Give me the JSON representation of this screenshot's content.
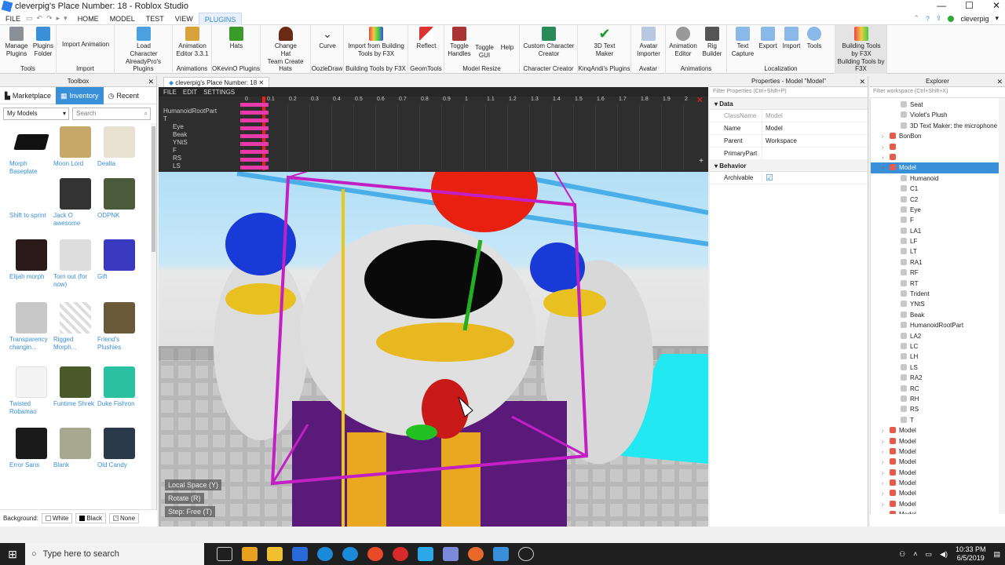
{
  "window": {
    "title": "cleverpig's Place Number: 18 - Roblox Studio",
    "min": "—",
    "max": "☐",
    "close": "✕"
  },
  "menubar": {
    "items": [
      "FILE",
      "HOME",
      "MODEL",
      "TEST",
      "VIEW",
      "PLUGINS"
    ],
    "active": "PLUGINS",
    "user": "cleverpig"
  },
  "ribbon": {
    "groups": [
      {
        "label": "Tools",
        "buttons": [
          "Manage Plugins",
          "Plugins Folder"
        ]
      },
      {
        "label": "Import",
        "buttons": [
          "Import Animation"
        ]
      },
      {
        "label": "AlreadyPro's Plugins",
        "buttons": [
          "Load Character"
        ]
      },
      {
        "label": "Animations",
        "buttons": [
          "Animation Editor 3.3.1"
        ]
      },
      {
        "label": "OKevinO Plugins",
        "buttons": [
          "Hats"
        ]
      },
      {
        "label": "Team Create Hats",
        "buttons": [
          "Change Hat"
        ]
      },
      {
        "label": "OozleDraw",
        "buttons": [
          "Curve"
        ]
      },
      {
        "label": "Building Tools by F3X",
        "buttons": [
          "Import from Building Tools by F3X"
        ]
      },
      {
        "label": "GeomTools",
        "buttons": [
          "Reflect"
        ]
      },
      {
        "label": "Model Resize",
        "buttons": [
          "Toggle Handles",
          "Toggle GUI",
          "Help"
        ]
      },
      {
        "label": "Character Creator",
        "buttons": [
          "Custom Character Creator"
        ]
      },
      {
        "label": "KinqAndi's Plugins",
        "buttons": [
          "3D Text Maker"
        ]
      },
      {
        "label": "Avatar",
        "buttons": [
          "Avatar Importer"
        ]
      },
      {
        "label": "Animations",
        "buttons": [
          "Animation Editor",
          "Rig Builder"
        ]
      },
      {
        "label": "Localization",
        "buttons": [
          "Text Capture",
          "Export",
          "Import",
          "Tools"
        ]
      },
      {
        "label": "Building Tools by F3X",
        "buttons": [
          "Building Tools by F3X"
        ]
      }
    ]
  },
  "toolbox": {
    "title": "Toolbox",
    "tabs": [
      "Marketplace",
      "Inventory",
      "Recent"
    ],
    "active_tab": "Inventory",
    "category": "My Models",
    "search_placeholder": "Search",
    "items": [
      "Morph Baseplate",
      "Moon Lord",
      "Dealta",
      "Shift to sprint",
      "Jack O awesome",
      "ODPNK",
      "Elijah morph",
      "Torn out (for now)",
      "Gift",
      "Transparency changin...",
      "Rigged Morph...",
      "Friend's Plushies",
      "Twisted Robamao",
      "Funtime Shrek",
      "Duke Fishron",
      "Error Sans",
      "Blank",
      "Old Candy"
    ],
    "background_label": "Background:",
    "background_options": [
      "White",
      "Black",
      "None"
    ]
  },
  "viewport": {
    "tab": "cleverpig's Place Number: 18",
    "anim_menu": [
      "FILE",
      "EDIT",
      "SETTINGS"
    ],
    "tracks": [
      "HumanoidRootPart",
      "T",
      "Eye",
      "Beak",
      "YNtS",
      "F",
      "RS",
      "LS"
    ],
    "ruler": [
      "0",
      "0.1",
      "0.2",
      "0.3",
      "0.4",
      "0.5",
      "0.6",
      "0.7",
      "0.8",
      "0.9",
      "1",
      "1.1",
      "1.2",
      "1.3",
      "1.4",
      "1.5",
      "1.6",
      "1.7",
      "1.8",
      "1.9",
      "2"
    ],
    "gizmo": [
      "Local Space (Y)",
      "Rotate (R)",
      "Step: Free (T)"
    ]
  },
  "properties": {
    "title": "Properties - Model \"Model\"",
    "filter_placeholder": "Filter Properties (Ctrl+Shift+P)",
    "sections": [
      {
        "name": "Data",
        "rows": [
          {
            "key": "ClassName",
            "value": "Model"
          },
          {
            "key": "Name",
            "value": "Model"
          },
          {
            "key": "Parent",
            "value": "Workspace"
          },
          {
            "key": "PrimaryPart",
            "value": ""
          }
        ]
      },
      {
        "name": "Behavior",
        "rows": [
          {
            "key": "Archivable",
            "value": "☑"
          }
        ]
      }
    ]
  },
  "explorer": {
    "title": "Explorer",
    "filter_placeholder": "Filter workspace (Ctrl+Shift+X)",
    "rows": [
      {
        "name": "Seat",
        "indent": 2
      },
      {
        "name": "Violet's Plush",
        "indent": 2
      },
      {
        "name": "3D Text Maker: the microphone is c",
        "indent": 2
      },
      {
        "name": "BonBon",
        "indent": 1
      },
      {
        "name": "",
        "indent": 1
      },
      {
        "name": "",
        "indent": 1
      },
      {
        "name": "Model",
        "indent": 1,
        "selected": true
      },
      {
        "name": "Humanoid",
        "indent": 2
      },
      {
        "name": "C1",
        "indent": 2
      },
      {
        "name": "C2",
        "indent": 2
      },
      {
        "name": "Eye",
        "indent": 2
      },
      {
        "name": "F",
        "indent": 2
      },
      {
        "name": "LA1",
        "indent": 2
      },
      {
        "name": "LF",
        "indent": 2
      },
      {
        "name": "LT",
        "indent": 2
      },
      {
        "name": "RA1",
        "indent": 2
      },
      {
        "name": "RF",
        "indent": 2
      },
      {
        "name": "RT",
        "indent": 2
      },
      {
        "name": "Trident",
        "indent": 2
      },
      {
        "name": "YNtS",
        "indent": 2
      },
      {
        "name": "Beak",
        "indent": 2
      },
      {
        "name": "HumanoidRootPart",
        "indent": 2
      },
      {
        "name": "LA2",
        "indent": 2
      },
      {
        "name": "LC",
        "indent": 2
      },
      {
        "name": "LH",
        "indent": 2
      },
      {
        "name": "LS",
        "indent": 2
      },
      {
        "name": "RA2",
        "indent": 2
      },
      {
        "name": "RC",
        "indent": 2
      },
      {
        "name": "RH",
        "indent": 2
      },
      {
        "name": "RS",
        "indent": 2
      },
      {
        "name": "T",
        "indent": 2
      },
      {
        "name": "Model",
        "indent": 1
      },
      {
        "name": "Model",
        "indent": 1
      },
      {
        "name": "Model",
        "indent": 1
      },
      {
        "name": "Model",
        "indent": 1
      },
      {
        "name": "Model",
        "indent": 1
      },
      {
        "name": "Model",
        "indent": 1
      },
      {
        "name": "Model",
        "indent": 1
      },
      {
        "name": "Model",
        "indent": 1
      },
      {
        "name": "Model",
        "indent": 1
      }
    ]
  },
  "taskbar": {
    "search_placeholder": "Type here to search",
    "time": "10:33 PM",
    "date": "6/5/2019"
  },
  "colors": {
    "accent": "#3a8fd9",
    "selection": "#3a8fd9",
    "magenta": "#c21fc4"
  }
}
